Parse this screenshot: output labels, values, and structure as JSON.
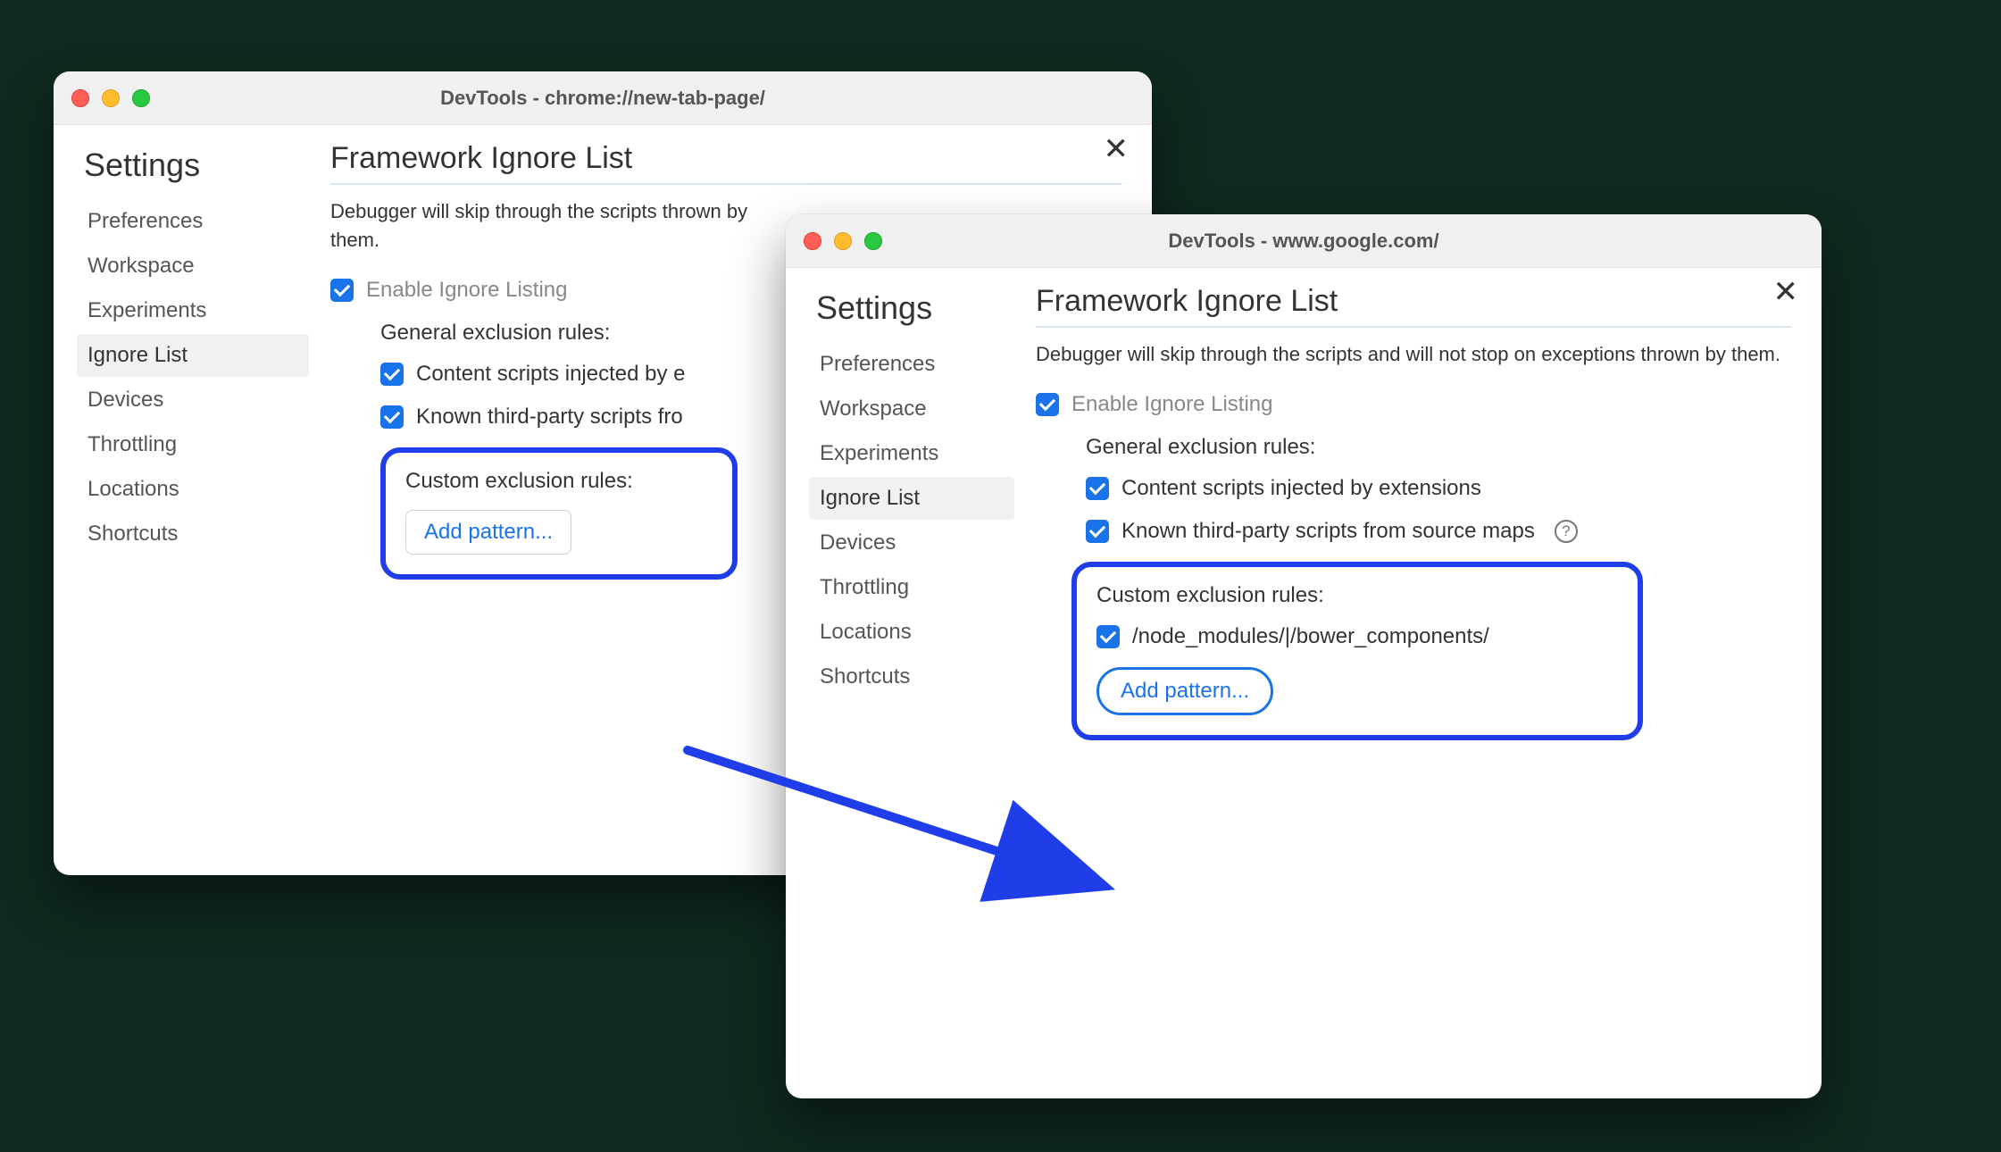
{
  "windows": {
    "left": {
      "title": "DevTools - chrome://new-tab-page/",
      "settings_title": "Settings",
      "sidebar": [
        "Preferences",
        "Workspace",
        "Experiments",
        "Ignore List",
        "Devices",
        "Throttling",
        "Locations",
        "Shortcuts"
      ],
      "panel": {
        "title": "Framework Ignore List",
        "desc_visible": "Debugger will skip through the scripts   thrown by them.",
        "enable_label": "Enable Ignore Listing",
        "general_heading": "General exclusion rules:",
        "rule1_visible": "Content scripts injected by e",
        "rule2_visible": "Known third-party scripts fro",
        "custom_heading": "Custom exclusion rules:",
        "add_pattern": "Add pattern..."
      }
    },
    "right": {
      "title": "DevTools - www.google.com/",
      "settings_title": "Settings",
      "sidebar": [
        "Preferences",
        "Workspace",
        "Experiments",
        "Ignore List",
        "Devices",
        "Throttling",
        "Locations",
        "Shortcuts"
      ],
      "panel": {
        "title": "Framework Ignore List",
        "desc": "Debugger will skip through the scripts and will not stop on exceptions thrown by them.",
        "enable_label": "Enable Ignore Listing",
        "general_heading": "General exclusion rules:",
        "rule1": "Content scripts injected by extensions",
        "rule2": "Known third-party scripts from source maps",
        "custom_heading": "Custom exclusion rules:",
        "custom_pattern": "/node_modules/|/bower_components/",
        "add_pattern": "Add pattern..."
      }
    }
  },
  "help_glyph": "?"
}
